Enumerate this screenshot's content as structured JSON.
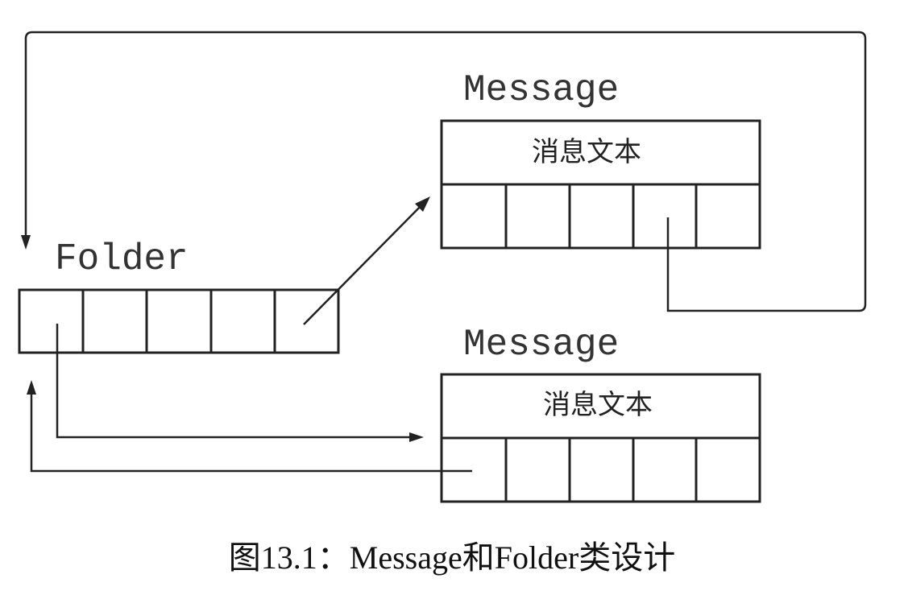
{
  "folder": {
    "label": "Folder"
  },
  "messages": [
    {
      "label": "Message",
      "text": "消息文本"
    },
    {
      "label": "Message",
      "text": "消息文本"
    }
  ],
  "caption": "图13.1：Message和Folder类设计"
}
